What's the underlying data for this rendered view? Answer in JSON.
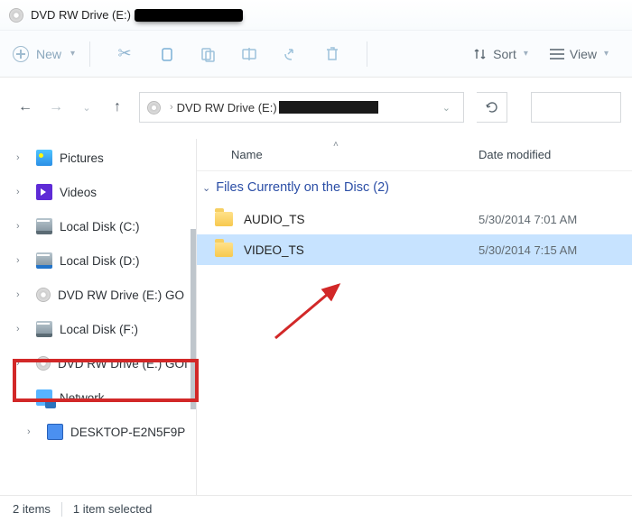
{
  "window": {
    "title": "DVD RW Drive (E:)"
  },
  "toolbar": {
    "new_label": "New",
    "sort_label": "Sort",
    "view_label": "View"
  },
  "address": {
    "path_label": "DVD RW Drive (E:)"
  },
  "sidebar": {
    "items": [
      {
        "label": "Pictures",
        "icon": "picture"
      },
      {
        "label": "Videos",
        "icon": "video"
      },
      {
        "label": "Local Disk (C:)",
        "icon": "drive"
      },
      {
        "label": "Local Disk (D:)",
        "icon": "drive-blue"
      },
      {
        "label": "DVD RW Drive (E:) GO",
        "icon": "dvd"
      },
      {
        "label": "Local Disk (F:)",
        "icon": "drive"
      },
      {
        "label": "DVD RW Drive (E:) GOI",
        "icon": "dvd",
        "highlighted": true
      },
      {
        "label": "Network",
        "icon": "network",
        "expanded": true
      },
      {
        "label": "DESKTOP-E2N5F9P",
        "icon": "pc",
        "child": true
      }
    ]
  },
  "columns": {
    "name": "Name",
    "date": "Date modified"
  },
  "group_header": "Files Currently on the Disc (2)",
  "rows": [
    {
      "name": "AUDIO_TS",
      "date": "5/30/2014 7:01 AM",
      "selected": false
    },
    {
      "name": "VIDEO_TS",
      "date": "5/30/2014 7:15 AM",
      "selected": true
    }
  ],
  "status": {
    "items_count": "2 items",
    "selected_text": "1 item selected"
  },
  "colors": {
    "selection": "#c7e3ff",
    "group_header": "#2b4ea6",
    "annotation": "#d22828"
  }
}
